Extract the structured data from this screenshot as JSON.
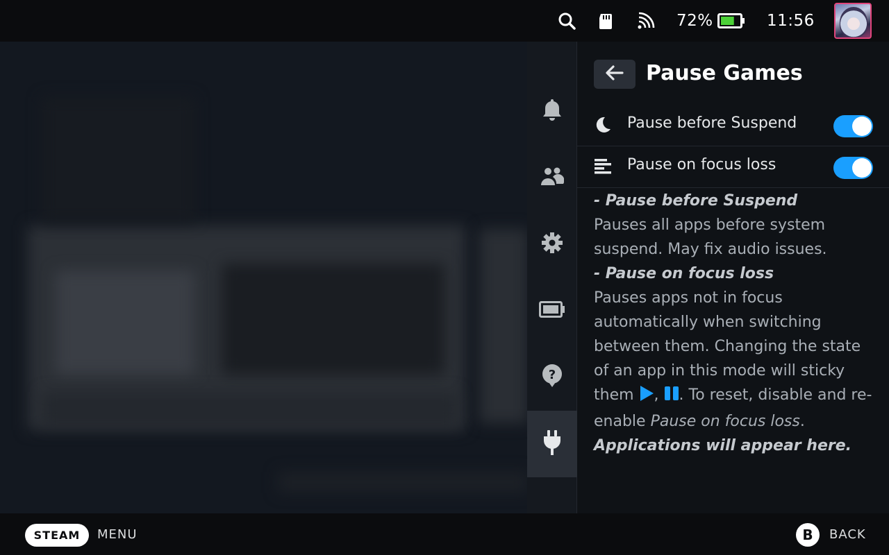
{
  "topbar": {
    "battery_percent": "72%",
    "battery_level": 0.72,
    "time": "11:56",
    "icons": [
      "search-icon",
      "sd-card-icon",
      "wifi-icon",
      "battery-icon",
      "avatar"
    ]
  },
  "rail": {
    "items": [
      {
        "icon": "bell-icon"
      },
      {
        "icon": "friends-icon"
      },
      {
        "icon": "gear-icon"
      },
      {
        "icon": "battery-icon"
      },
      {
        "icon": "help-icon"
      },
      {
        "icon": "plug-icon",
        "active": true
      }
    ]
  },
  "panel": {
    "title": "Pause Games",
    "settings": [
      {
        "label": "Pause before Suspend",
        "icon": "moon-icon",
        "enabled": true
      },
      {
        "label": "Pause on focus loss",
        "icon": "list-icon",
        "enabled": true
      }
    ],
    "description": {
      "heading1": "- Pause before Suspend",
      "text1": "Pauses all apps before system suspend. May fix audio issues.",
      "heading2": "- Pause on focus loss",
      "text2a": "Pauses apps not in focus automatically when switching between them. Changing the state of an app in this mode will sticky them",
      "text2b": ",",
      "text2c": ". To reset, disable and re-enable",
      "text2d": "Pause on focus loss",
      "text2e": ".",
      "footer": "Applications will appear here."
    }
  },
  "bottombar": {
    "steam_label": "STEAM",
    "menu_label": "MENU",
    "b_label": "B",
    "back_label": "BACK"
  },
  "colors": {
    "accent": "#1a9fff",
    "avatar_border": "#e0457b",
    "battery_fill": "#4cd137"
  }
}
